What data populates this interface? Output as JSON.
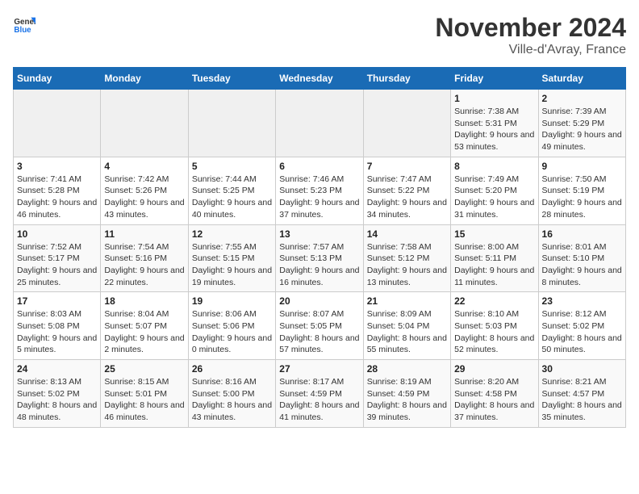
{
  "header": {
    "logo_line1": "General",
    "logo_line2": "Blue",
    "month": "November 2024",
    "location": "Ville-d'Avray, France"
  },
  "weekdays": [
    "Sunday",
    "Monday",
    "Tuesday",
    "Wednesday",
    "Thursday",
    "Friday",
    "Saturday"
  ],
  "weeks": [
    [
      {
        "day": "",
        "info": ""
      },
      {
        "day": "",
        "info": ""
      },
      {
        "day": "",
        "info": ""
      },
      {
        "day": "",
        "info": ""
      },
      {
        "day": "",
        "info": ""
      },
      {
        "day": "1",
        "info": "Sunrise: 7:38 AM\nSunset: 5:31 PM\nDaylight: 9 hours and 53 minutes."
      },
      {
        "day": "2",
        "info": "Sunrise: 7:39 AM\nSunset: 5:29 PM\nDaylight: 9 hours and 49 minutes."
      }
    ],
    [
      {
        "day": "3",
        "info": "Sunrise: 7:41 AM\nSunset: 5:28 PM\nDaylight: 9 hours and 46 minutes."
      },
      {
        "day": "4",
        "info": "Sunrise: 7:42 AM\nSunset: 5:26 PM\nDaylight: 9 hours and 43 minutes."
      },
      {
        "day": "5",
        "info": "Sunrise: 7:44 AM\nSunset: 5:25 PM\nDaylight: 9 hours and 40 minutes."
      },
      {
        "day": "6",
        "info": "Sunrise: 7:46 AM\nSunset: 5:23 PM\nDaylight: 9 hours and 37 minutes."
      },
      {
        "day": "7",
        "info": "Sunrise: 7:47 AM\nSunset: 5:22 PM\nDaylight: 9 hours and 34 minutes."
      },
      {
        "day": "8",
        "info": "Sunrise: 7:49 AM\nSunset: 5:20 PM\nDaylight: 9 hours and 31 minutes."
      },
      {
        "day": "9",
        "info": "Sunrise: 7:50 AM\nSunset: 5:19 PM\nDaylight: 9 hours and 28 minutes."
      }
    ],
    [
      {
        "day": "10",
        "info": "Sunrise: 7:52 AM\nSunset: 5:17 PM\nDaylight: 9 hours and 25 minutes."
      },
      {
        "day": "11",
        "info": "Sunrise: 7:54 AM\nSunset: 5:16 PM\nDaylight: 9 hours and 22 minutes."
      },
      {
        "day": "12",
        "info": "Sunrise: 7:55 AM\nSunset: 5:15 PM\nDaylight: 9 hours and 19 minutes."
      },
      {
        "day": "13",
        "info": "Sunrise: 7:57 AM\nSunset: 5:13 PM\nDaylight: 9 hours and 16 minutes."
      },
      {
        "day": "14",
        "info": "Sunrise: 7:58 AM\nSunset: 5:12 PM\nDaylight: 9 hours and 13 minutes."
      },
      {
        "day": "15",
        "info": "Sunrise: 8:00 AM\nSunset: 5:11 PM\nDaylight: 9 hours and 11 minutes."
      },
      {
        "day": "16",
        "info": "Sunrise: 8:01 AM\nSunset: 5:10 PM\nDaylight: 9 hours and 8 minutes."
      }
    ],
    [
      {
        "day": "17",
        "info": "Sunrise: 8:03 AM\nSunset: 5:08 PM\nDaylight: 9 hours and 5 minutes."
      },
      {
        "day": "18",
        "info": "Sunrise: 8:04 AM\nSunset: 5:07 PM\nDaylight: 9 hours and 2 minutes."
      },
      {
        "day": "19",
        "info": "Sunrise: 8:06 AM\nSunset: 5:06 PM\nDaylight: 9 hours and 0 minutes."
      },
      {
        "day": "20",
        "info": "Sunrise: 8:07 AM\nSunset: 5:05 PM\nDaylight: 8 hours and 57 minutes."
      },
      {
        "day": "21",
        "info": "Sunrise: 8:09 AM\nSunset: 5:04 PM\nDaylight: 8 hours and 55 minutes."
      },
      {
        "day": "22",
        "info": "Sunrise: 8:10 AM\nSunset: 5:03 PM\nDaylight: 8 hours and 52 minutes."
      },
      {
        "day": "23",
        "info": "Sunrise: 8:12 AM\nSunset: 5:02 PM\nDaylight: 8 hours and 50 minutes."
      }
    ],
    [
      {
        "day": "24",
        "info": "Sunrise: 8:13 AM\nSunset: 5:02 PM\nDaylight: 8 hours and 48 minutes."
      },
      {
        "day": "25",
        "info": "Sunrise: 8:15 AM\nSunset: 5:01 PM\nDaylight: 8 hours and 46 minutes."
      },
      {
        "day": "26",
        "info": "Sunrise: 8:16 AM\nSunset: 5:00 PM\nDaylight: 8 hours and 43 minutes."
      },
      {
        "day": "27",
        "info": "Sunrise: 8:17 AM\nSunset: 4:59 PM\nDaylight: 8 hours and 41 minutes."
      },
      {
        "day": "28",
        "info": "Sunrise: 8:19 AM\nSunset: 4:59 PM\nDaylight: 8 hours and 39 minutes."
      },
      {
        "day": "29",
        "info": "Sunrise: 8:20 AM\nSunset: 4:58 PM\nDaylight: 8 hours and 37 minutes."
      },
      {
        "day": "30",
        "info": "Sunrise: 8:21 AM\nSunset: 4:57 PM\nDaylight: 8 hours and 35 minutes."
      }
    ]
  ]
}
